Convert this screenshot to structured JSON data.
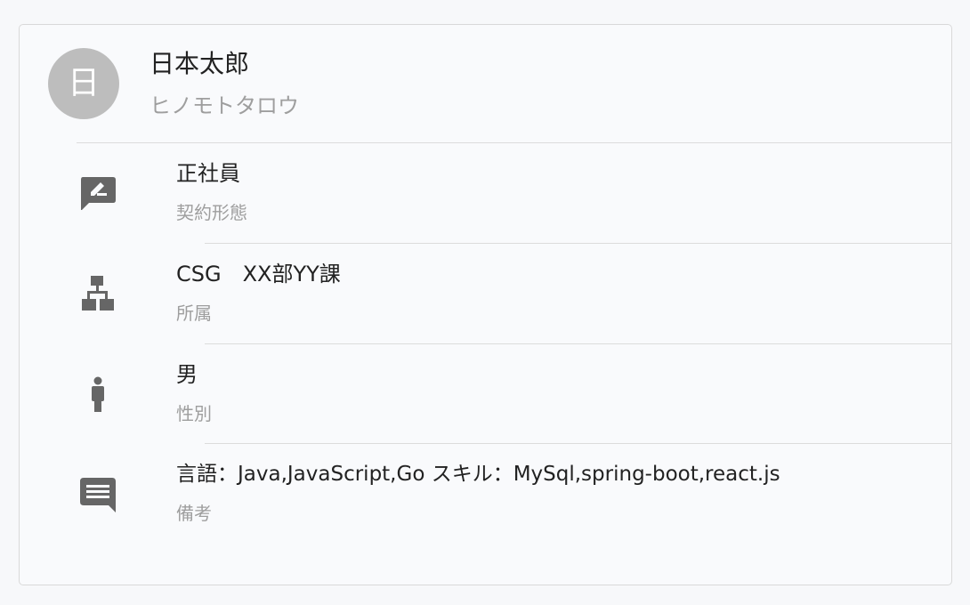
{
  "profile": {
    "avatar_initial": "日",
    "name": "日本太郎",
    "kana": "ヒノモトタロウ"
  },
  "fields": [
    {
      "icon": "edit-comment-icon",
      "value": "正社員",
      "label": "契約形態"
    },
    {
      "icon": "org-chart-icon",
      "value": "CSG　XX部YY課",
      "label": "所属"
    },
    {
      "icon": "person-icon",
      "value": "男",
      "label": "性別"
    },
    {
      "icon": "comment-icon",
      "value": "言語：Java,JavaScript,Go スキル：MySql,spring-boot,react.js",
      "label": "備考"
    }
  ],
  "colors": {
    "icon": "#666666",
    "avatar": "#bdbdbd",
    "primary_text": "#222222",
    "secondary_text": "#9e9e9e"
  }
}
